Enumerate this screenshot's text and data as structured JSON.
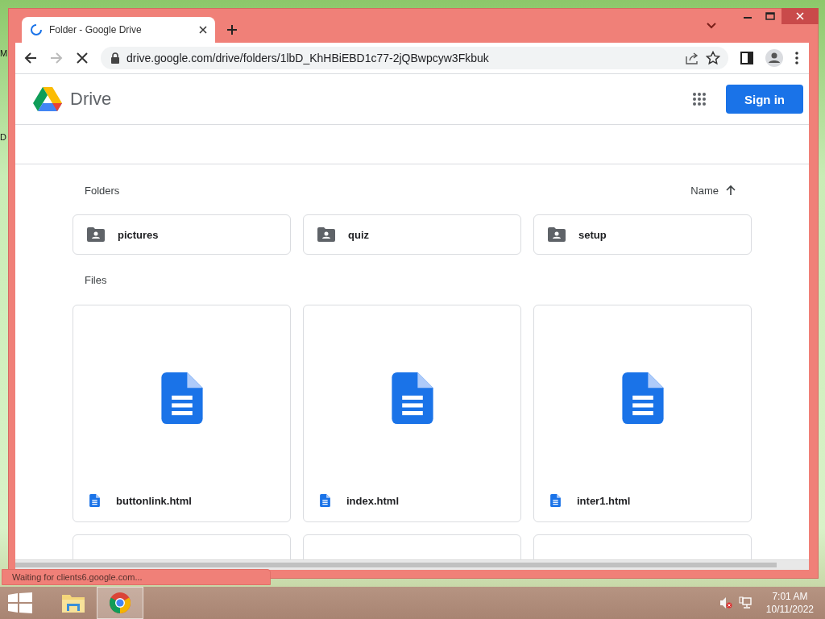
{
  "desktop": {
    "labels": [
      "M",
      "D"
    ]
  },
  "browser": {
    "tabs": [
      {
        "title": "Folder - Google Drive",
        "selected": true,
        "loading": true
      }
    ],
    "address": "drive.google.com/drive/folders/1lbD_KhHBiEBD1c77-2jQBwpcyw3Fkbuk",
    "loading": true,
    "status": "Waiting for clients6.google.com..."
  },
  "page": {
    "logo_text": "Drive",
    "sign_in": "Sign in",
    "folders_heading": "Folders",
    "sort_label": "Name",
    "folders": [
      {
        "name": "pictures"
      },
      {
        "name": "quiz"
      },
      {
        "name": "setup"
      }
    ],
    "files_heading": "Files",
    "files": [
      {
        "kind": "full",
        "name": "buttonlink.html"
      },
      {
        "kind": "full",
        "name": "index.html"
      },
      {
        "kind": "full",
        "name": "inter1.html"
      },
      {
        "kind": "partial"
      },
      {
        "kind": "partial"
      },
      {
        "kind": "partial"
      }
    ]
  },
  "taskbar": {
    "apps": [
      {
        "kind": "explorer",
        "selected": false
      },
      {
        "kind": "chrome",
        "selected": true
      }
    ],
    "time": "7:01 AM",
    "date": "10/11/2022"
  }
}
